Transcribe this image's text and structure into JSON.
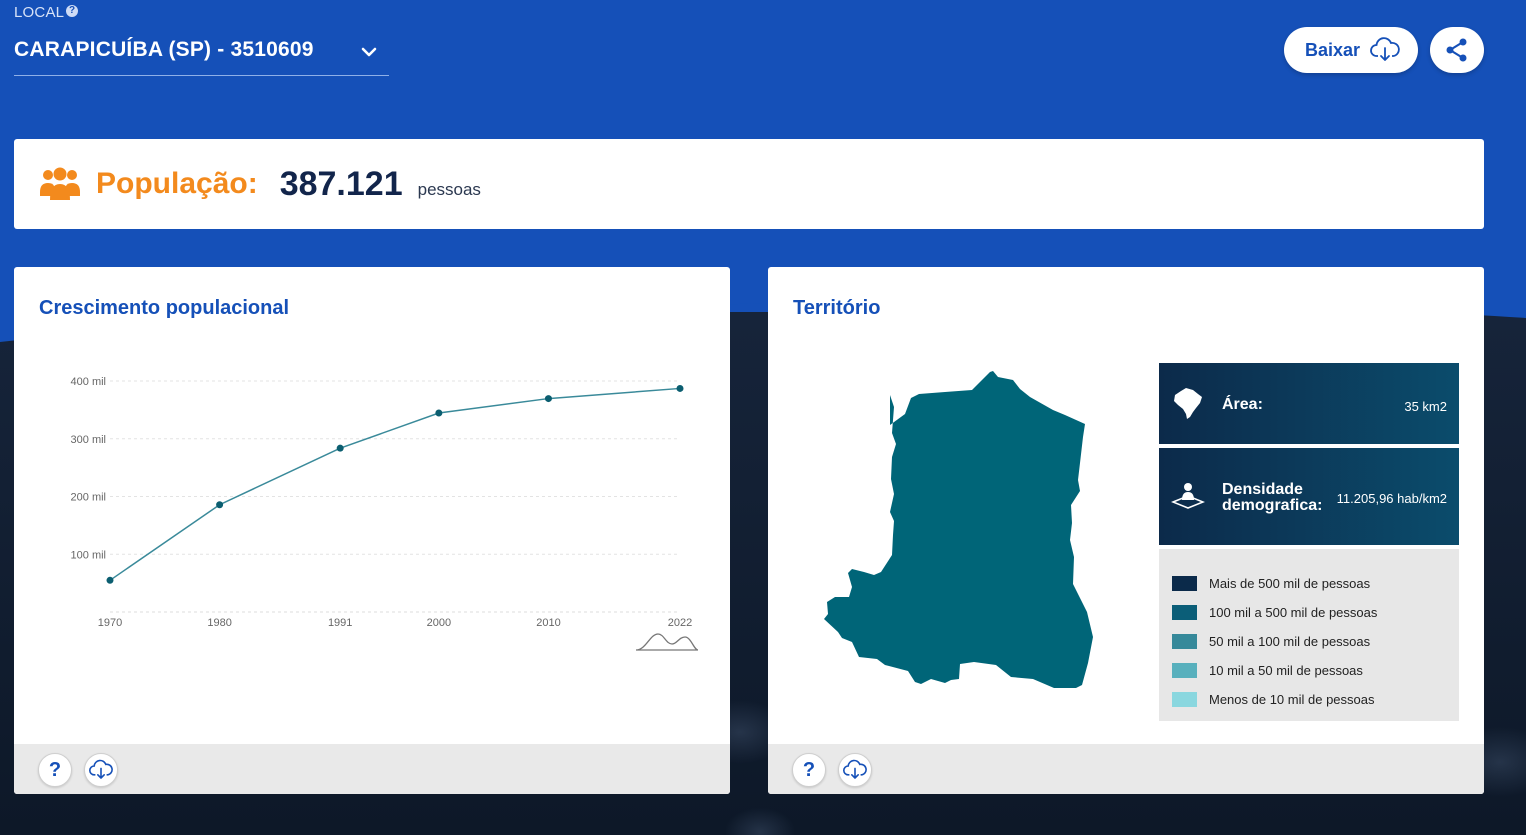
{
  "local": {
    "label": "LOCAL",
    "help": "?",
    "selected": "CARAPICUÍBA (SP) - 3510609"
  },
  "toolbar": {
    "download_label": "Baixar"
  },
  "population": {
    "label": "População:",
    "value": "387.121",
    "unit": "pessoas"
  },
  "growth_card": {
    "title": "Crescimento populacional",
    "help_label": "?"
  },
  "chart_data": {
    "type": "line",
    "x": [
      "1970",
      "1980",
      "1991",
      "2000",
      "2010",
      "2022"
    ],
    "series": [
      {
        "values": [
          54873,
          185747,
          283661,
          344596,
          369584,
          387121
        ]
      }
    ],
    "y_ticks": [
      "100 mil",
      "200 mil",
      "300 mil",
      "400 mil"
    ],
    "ylim": [
      0,
      400000
    ],
    "grid": true,
    "line_color": "#3a8a9a",
    "point_color": "#0b5e70"
  },
  "territory_card": {
    "title": "Território",
    "help_label": "?",
    "area_label": "Área:",
    "area_value": "35 km2",
    "density_label_1": "Densidade",
    "density_label_2": "demografica:",
    "density_value": "11.205,96 hab/km2",
    "map_color": "#006578",
    "legend": [
      {
        "label": "Mais de 500 mil de pessoas",
        "color": "#0b2a4a"
      },
      {
        "label": "100 mil a 500 mil de pessoas",
        "color": "#0b5e78"
      },
      {
        "label": "50 mil a 100 mil de pessoas",
        "color": "#36899a"
      },
      {
        "label": "10 mil a 50 mil de pessoas",
        "color": "#58b0bd"
      },
      {
        "label": "Menos de 10 mil de pessoas",
        "color": "#8ad7df"
      }
    ]
  },
  "icons": [
    "help-icon",
    "chevron-down-icon",
    "cloud-download-icon",
    "share-icon",
    "people-icon",
    "brazil-map-icon",
    "person-density-icon",
    "line-trend-icon"
  ]
}
